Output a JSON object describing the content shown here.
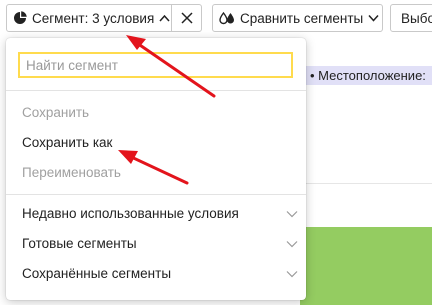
{
  "toolbar": {
    "segment_label": "Сегмент: 3 условия",
    "compare_label": "Сравнить сегменты",
    "choose_label": "Выбо"
  },
  "background": {
    "tag_text": "• Местоположение:"
  },
  "dropdown": {
    "search_placeholder": "Найти сегмент",
    "actions": [
      {
        "label": "Сохранить",
        "enabled": false
      },
      {
        "label": "Сохранить как",
        "enabled": true
      },
      {
        "label": "Переименовать",
        "enabled": false
      }
    ],
    "categories": [
      {
        "label": "Недавно использованные условия"
      },
      {
        "label": "Готовые сегменты"
      },
      {
        "label": "Сохранённые сегменты"
      }
    ]
  },
  "colors": {
    "arrow": "#e3141c",
    "search_border": "#ffdb4d",
    "tag_bg": "#e1e0f7",
    "green_area": "#94cc61"
  }
}
